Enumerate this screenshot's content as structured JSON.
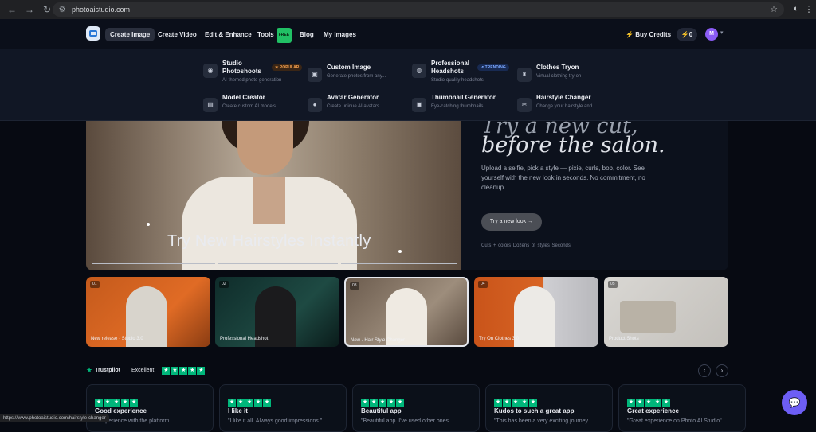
{
  "browser": {
    "url": "photoaistudio.com",
    "status_url": "https://www.photoaistudio.com/hairstyle-changer"
  },
  "nav": {
    "items": [
      {
        "label": "Create Image"
      },
      {
        "label": "Create Video"
      },
      {
        "label": "Edit & Enhance"
      },
      {
        "label": "Tools",
        "badge": "FREE"
      },
      {
        "label": "Blog"
      },
      {
        "label": "My Images"
      }
    ],
    "buy_credits": "Buy Credits",
    "credits": "0",
    "avatar_initial": "M"
  },
  "menu": {
    "items": [
      {
        "title": "Studio Photoshoots",
        "desc": "AI-themed photo generation",
        "badge": "POPULAR",
        "icon": "camera-icon"
      },
      {
        "title": "Custom Image",
        "desc": "Generate photos from any...",
        "icon": "image-icon"
      },
      {
        "title": "Professional Headshots",
        "desc": "Studio-quality headshots",
        "badge": "TRENDING",
        "icon": "person-icon"
      },
      {
        "title": "Clothes Tryon",
        "desc": "Virtual clothing try-on",
        "icon": "shirt-icon"
      },
      {
        "title": "Model Creator",
        "desc": "Create custom AI models",
        "icon": "id-card-icon"
      },
      {
        "title": "Avatar Generator",
        "desc": "Create unique AI avatars",
        "icon": "user-icon"
      },
      {
        "title": "Thumbnail Generator",
        "desc": "Eye-catching thumbnails",
        "icon": "image-icon"
      },
      {
        "title": "Hairstyle Changer",
        "desc": "Change your hairstyle and...",
        "icon": "scissors-icon"
      }
    ]
  },
  "hero": {
    "title_line1": "Try a new cut,",
    "title_line2": "before the salon.",
    "description": "Upload a selfie, pick a style — pixie, curls, bob, color. See yourself with the new look in seconds. No commitment, no cleanup.",
    "cta": "Try a new look →",
    "tags": "Cuts + colors  Dozens of styles  Seconds",
    "image_caption": "Try New Hairstyles Instantly"
  },
  "cards": [
    {
      "num": "01",
      "label": "New release · Studio 3.0"
    },
    {
      "num": "02",
      "label": "Professional Headshot"
    },
    {
      "num": "03",
      "label": "New · Hair Style Changer"
    },
    {
      "num": "04",
      "label": "Try On Clothes 3.0"
    },
    {
      "num": "05",
      "label": "Product Shots"
    }
  ],
  "trust": {
    "brand": "Trustpilot",
    "rating_word": "Excellent",
    "stars": "★★★★★"
  },
  "reviews": [
    {
      "title": "Good experience",
      "quote": "...experience with the platform..."
    },
    {
      "title": "I like it",
      "quote": "\"I like it all. Always good impressions.\""
    },
    {
      "title": "Beautiful app",
      "quote": "\"Beautiful app. I've used other ones..."
    },
    {
      "title": "Kudos to such a great app",
      "quote": "\"This has been a very exciting journey..."
    },
    {
      "title": "Great experience",
      "quote": "\"Great experience on Photo AI Studio\""
    }
  ],
  "colors": {
    "highlight": "#f3a818",
    "trustpilot": "#00b67a",
    "popular": "#f6a04d",
    "trending": "#7aa7ff",
    "free": "#21c065"
  }
}
